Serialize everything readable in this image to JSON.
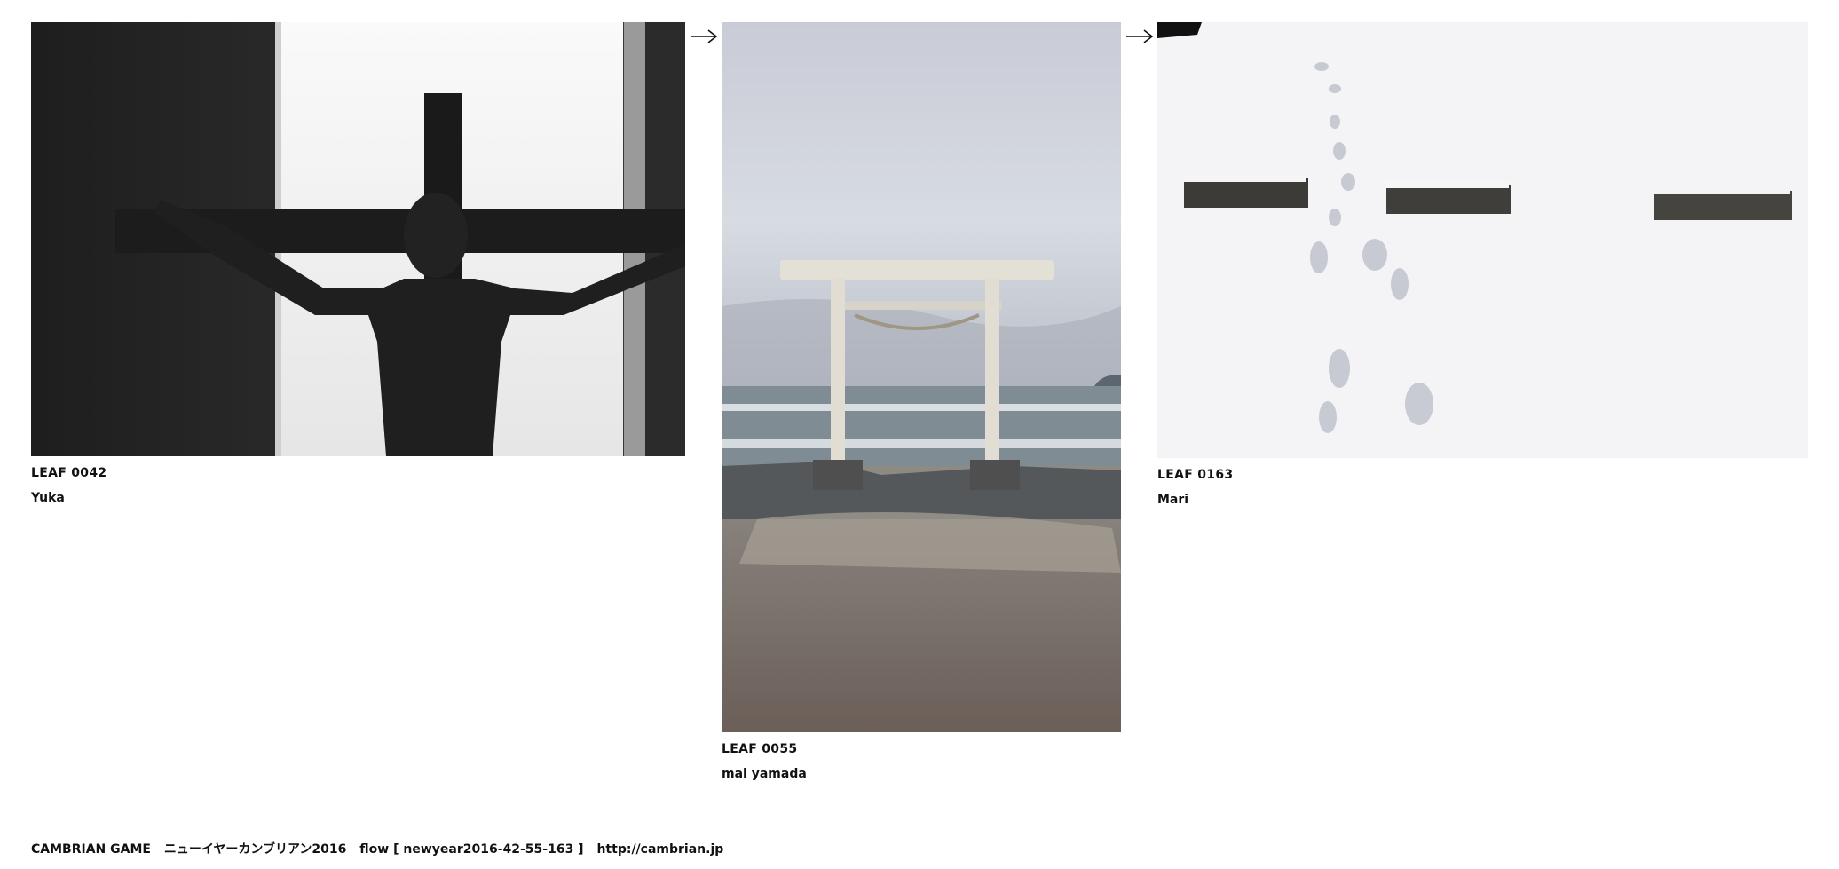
{
  "leaves": [
    {
      "id": "LEAF 0042",
      "author": "Yuka",
      "photo_icon": "crucifix-photo"
    },
    {
      "id": "LEAF 0055",
      "author": "mai yamada",
      "photo_icon": "torii-gate-photo"
    },
    {
      "id": "LEAF 0163",
      "author": "Mari",
      "photo_icon": "snow-footprints-photo"
    }
  ],
  "arrows": [
    "right-arrow-icon",
    "right-arrow-icon"
  ],
  "footer": {
    "brand": "CAMBRIAN GAME",
    "event": "ニューイヤーカンブリアン2016",
    "flow": "flow [ newyear2016-42-55-163 ]",
    "url": "http://cambrian.jp"
  }
}
